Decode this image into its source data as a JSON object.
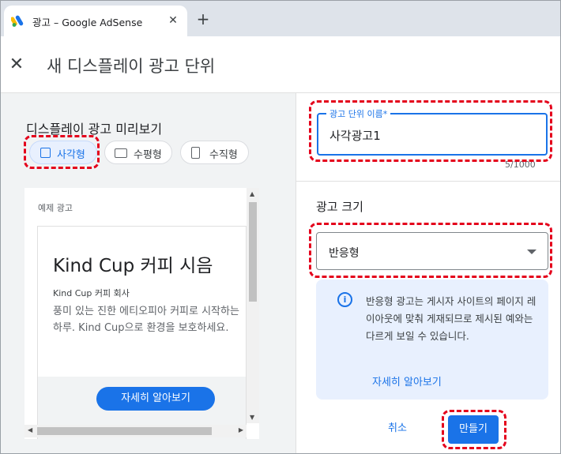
{
  "browser": {
    "tab_title": "광고 – Google AdSense",
    "tab_close_icon": "close-icon",
    "new_tab_label": "+"
  },
  "header": {
    "close_icon": "close-icon",
    "close_glyph": "✕",
    "title": "새 디스플레이 광고 단위"
  },
  "preview": {
    "title": "디스플레이 광고 미리보기",
    "shapes": [
      {
        "label": "사각형",
        "icon": "square-icon",
        "selected": true
      },
      {
        "label": "수평형",
        "icon": "horizontal-rect-icon",
        "selected": false
      },
      {
        "label": "수직형",
        "icon": "vertical-rect-icon",
        "selected": false
      }
    ],
    "sample_label": "예제 광고",
    "ad": {
      "headline": "Kind Cup 커피 시음",
      "company": "Kind Cup 커피 회사",
      "body": "풍미 있는 진한 에티오피아 커피로 시작하는 하루. Kind Cup으로 환경을 보호하세요.",
      "button": "자세히 알아보기"
    }
  },
  "settings": {
    "name_label": "광고 단위 이름*",
    "name_value": "사각광고1",
    "name_counter": "5/1000",
    "size_title": "광고 크기",
    "size_value": "반응형",
    "info_icon": "info-icon",
    "info_text": "반응형 광고는 게시자 사이트의 페이지 레이아웃에 맞춰 게재되므로 제시된 예와는 다르게 보일 수 있습니다.",
    "learn_more": "자세히 알아보기",
    "cancel": "취소",
    "create": "만들기"
  },
  "colors": {
    "accent": "#1a73e8",
    "highlight": "#e4001b",
    "pane_bg": "#f1f3f4",
    "info_bg": "#e8f0fe"
  }
}
